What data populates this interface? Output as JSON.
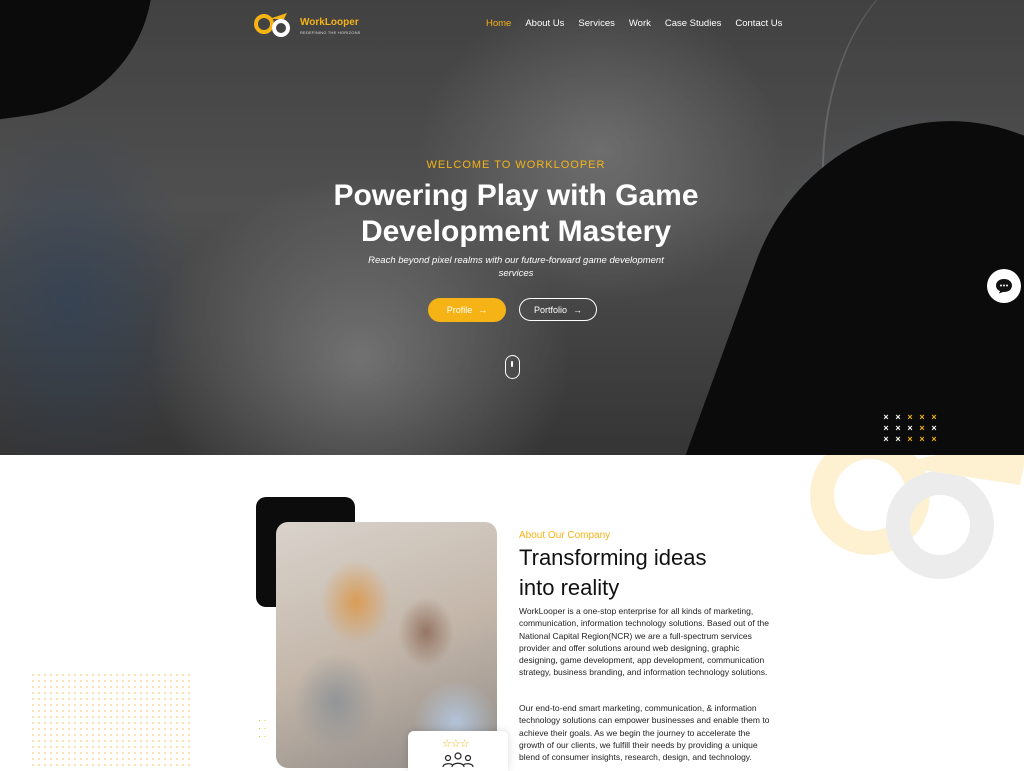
{
  "brand": {
    "name": "WorkLooper",
    "tagline": "REDEFINING THE HORIZONS",
    "accent": "#f5b316"
  },
  "nav": {
    "items": [
      {
        "label": "Home",
        "active": true
      },
      {
        "label": "About Us"
      },
      {
        "label": "Services"
      },
      {
        "label": "Work"
      },
      {
        "label": "Case Studies"
      },
      {
        "label": "Contact Us"
      }
    ]
  },
  "hero": {
    "kicker": "WELCOME TO WORKLOOPER",
    "title_line1": "Powering Play with Game",
    "title_line2": "Development Mastery",
    "subtitle": "Reach beyond pixel realms with our future-forward game development services",
    "btn_profile": "Profile",
    "btn_portfolio": "Portfolio",
    "arrow": "→"
  },
  "about": {
    "kicker": "About Our Company",
    "title_line1": "Transforming ideas",
    "title_line2": "into reality",
    "paragraph1": "WorkLooper is a one-stop enterprise for all kinds of marketing, communication, information technology solutions. Based out of the National Capital Region(NCR) we are a full-spectrum services provider and offer solutions around web designing, graphic designing, game development, app development, communication strategy, business branding, and information technology solutions.",
    "paragraph2": "Our end-to-end smart marketing, communication, & information technology solutions can empower businesses and enable them to achieve their goals. As we begin the journey to accelerate the growth of our clients, we fulfill their needs by providing a unique blend of consumer insights, research, design, and technology.",
    "stars": "☆☆☆"
  }
}
